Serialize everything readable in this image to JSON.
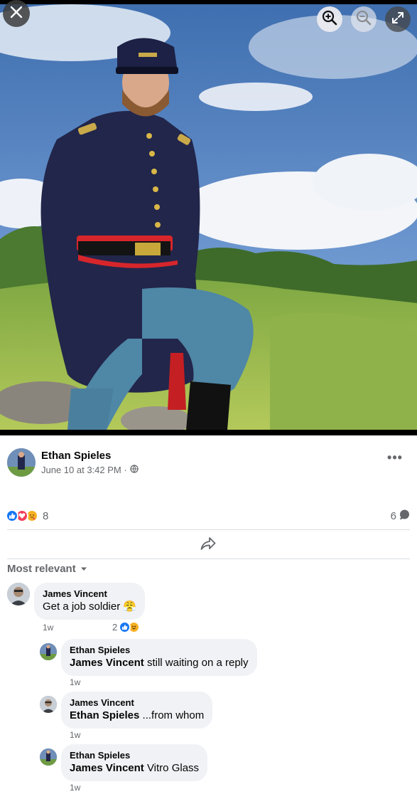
{
  "viewer": {
    "close_icon": "close-icon",
    "zoom_in_icon": "zoom-in-icon",
    "zoom_out_icon": "zoom-out-icon",
    "expand_icon": "expand-icon"
  },
  "post": {
    "author": "Ethan Spieles",
    "timestamp": "June 10 at 3:42 PM ·",
    "audience_icon": "globe-icon",
    "more_label": "•••",
    "reaction_count": "8",
    "reactions": [
      "like",
      "love",
      "care"
    ],
    "comment_count": "6",
    "share_icon": "share-icon"
  },
  "sort": {
    "label": "Most relevant"
  },
  "comments": [
    {
      "author": "James Vincent",
      "mention": "",
      "text": "Get a job soldier 😤",
      "time": "1w",
      "reaction_count": "2",
      "reactions": [
        "like",
        "haha"
      ]
    },
    {
      "author": "Ethan Spieles",
      "mention": "James Vincent",
      "text": " still waiting on a reply",
      "time": "1w"
    },
    {
      "author": "James Vincent",
      "mention": "Ethan Spieles",
      "text": " ...from whom",
      "time": "1w"
    },
    {
      "author": "Ethan Spieles",
      "mention": "James Vincent",
      "text": " Vitro Glass",
      "time": "1w"
    }
  ],
  "colors": {
    "like_blue": "#1877f2",
    "love_red": "#f33e58",
    "care_yellow": "#f7b125",
    "meta_gray": "#65676b",
    "bubble_bg": "#f0f2f5"
  }
}
